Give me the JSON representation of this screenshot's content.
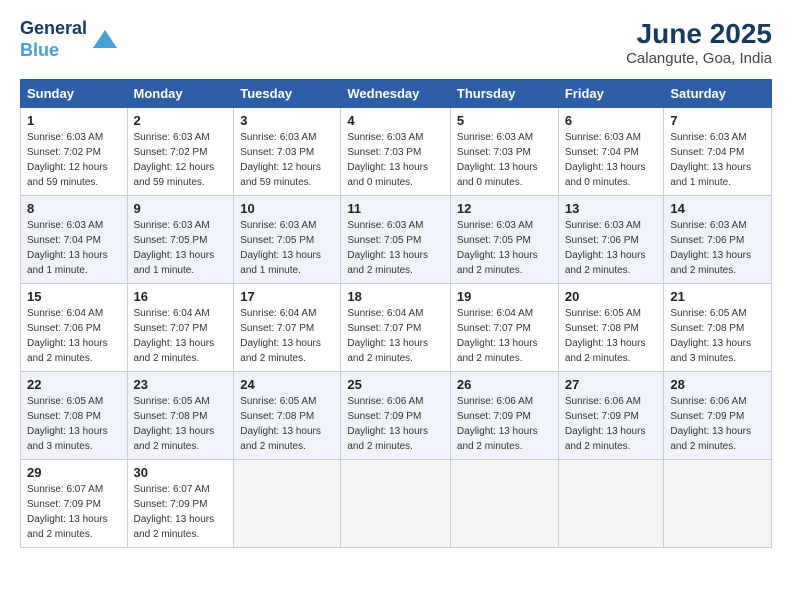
{
  "header": {
    "logo_line1": "General",
    "logo_line2": "Blue",
    "title": "June 2025",
    "subtitle": "Calangute, Goa, India"
  },
  "days_of_week": [
    "Sunday",
    "Monday",
    "Tuesday",
    "Wednesday",
    "Thursday",
    "Friday",
    "Saturday"
  ],
  "weeks": [
    [
      {
        "day": "1",
        "sunrise": "Sunrise: 6:03 AM",
        "sunset": "Sunset: 7:02 PM",
        "daylight": "Daylight: 12 hours and 59 minutes."
      },
      {
        "day": "2",
        "sunrise": "Sunrise: 6:03 AM",
        "sunset": "Sunset: 7:02 PM",
        "daylight": "Daylight: 12 hours and 59 minutes."
      },
      {
        "day": "3",
        "sunrise": "Sunrise: 6:03 AM",
        "sunset": "Sunset: 7:03 PM",
        "daylight": "Daylight: 12 hours and 59 minutes."
      },
      {
        "day": "4",
        "sunrise": "Sunrise: 6:03 AM",
        "sunset": "Sunset: 7:03 PM",
        "daylight": "Daylight: 13 hours and 0 minutes."
      },
      {
        "day": "5",
        "sunrise": "Sunrise: 6:03 AM",
        "sunset": "Sunset: 7:03 PM",
        "daylight": "Daylight: 13 hours and 0 minutes."
      },
      {
        "day": "6",
        "sunrise": "Sunrise: 6:03 AM",
        "sunset": "Sunset: 7:04 PM",
        "daylight": "Daylight: 13 hours and 0 minutes."
      },
      {
        "day": "7",
        "sunrise": "Sunrise: 6:03 AM",
        "sunset": "Sunset: 7:04 PM",
        "daylight": "Daylight: 13 hours and 1 minute."
      }
    ],
    [
      {
        "day": "8",
        "sunrise": "Sunrise: 6:03 AM",
        "sunset": "Sunset: 7:04 PM",
        "daylight": "Daylight: 13 hours and 1 minute."
      },
      {
        "day": "9",
        "sunrise": "Sunrise: 6:03 AM",
        "sunset": "Sunset: 7:05 PM",
        "daylight": "Daylight: 13 hours and 1 minute."
      },
      {
        "day": "10",
        "sunrise": "Sunrise: 6:03 AM",
        "sunset": "Sunset: 7:05 PM",
        "daylight": "Daylight: 13 hours and 1 minute."
      },
      {
        "day": "11",
        "sunrise": "Sunrise: 6:03 AM",
        "sunset": "Sunset: 7:05 PM",
        "daylight": "Daylight: 13 hours and 2 minutes."
      },
      {
        "day": "12",
        "sunrise": "Sunrise: 6:03 AM",
        "sunset": "Sunset: 7:05 PM",
        "daylight": "Daylight: 13 hours and 2 minutes."
      },
      {
        "day": "13",
        "sunrise": "Sunrise: 6:03 AM",
        "sunset": "Sunset: 7:06 PM",
        "daylight": "Daylight: 13 hours and 2 minutes."
      },
      {
        "day": "14",
        "sunrise": "Sunrise: 6:03 AM",
        "sunset": "Sunset: 7:06 PM",
        "daylight": "Daylight: 13 hours and 2 minutes."
      }
    ],
    [
      {
        "day": "15",
        "sunrise": "Sunrise: 6:04 AM",
        "sunset": "Sunset: 7:06 PM",
        "daylight": "Daylight: 13 hours and 2 minutes."
      },
      {
        "day": "16",
        "sunrise": "Sunrise: 6:04 AM",
        "sunset": "Sunset: 7:07 PM",
        "daylight": "Daylight: 13 hours and 2 minutes."
      },
      {
        "day": "17",
        "sunrise": "Sunrise: 6:04 AM",
        "sunset": "Sunset: 7:07 PM",
        "daylight": "Daylight: 13 hours and 2 minutes."
      },
      {
        "day": "18",
        "sunrise": "Sunrise: 6:04 AM",
        "sunset": "Sunset: 7:07 PM",
        "daylight": "Daylight: 13 hours and 2 minutes."
      },
      {
        "day": "19",
        "sunrise": "Sunrise: 6:04 AM",
        "sunset": "Sunset: 7:07 PM",
        "daylight": "Daylight: 13 hours and 2 minutes."
      },
      {
        "day": "20",
        "sunrise": "Sunrise: 6:05 AM",
        "sunset": "Sunset: 7:08 PM",
        "daylight": "Daylight: 13 hours and 2 minutes."
      },
      {
        "day": "21",
        "sunrise": "Sunrise: 6:05 AM",
        "sunset": "Sunset: 7:08 PM",
        "daylight": "Daylight: 13 hours and 3 minutes."
      }
    ],
    [
      {
        "day": "22",
        "sunrise": "Sunrise: 6:05 AM",
        "sunset": "Sunset: 7:08 PM",
        "daylight": "Daylight: 13 hours and 3 minutes."
      },
      {
        "day": "23",
        "sunrise": "Sunrise: 6:05 AM",
        "sunset": "Sunset: 7:08 PM",
        "daylight": "Daylight: 13 hours and 2 minutes."
      },
      {
        "day": "24",
        "sunrise": "Sunrise: 6:05 AM",
        "sunset": "Sunset: 7:08 PM",
        "daylight": "Daylight: 13 hours and 2 minutes."
      },
      {
        "day": "25",
        "sunrise": "Sunrise: 6:06 AM",
        "sunset": "Sunset: 7:09 PM",
        "daylight": "Daylight: 13 hours and 2 minutes."
      },
      {
        "day": "26",
        "sunrise": "Sunrise: 6:06 AM",
        "sunset": "Sunset: 7:09 PM",
        "daylight": "Daylight: 13 hours and 2 minutes."
      },
      {
        "day": "27",
        "sunrise": "Sunrise: 6:06 AM",
        "sunset": "Sunset: 7:09 PM",
        "daylight": "Daylight: 13 hours and 2 minutes."
      },
      {
        "day": "28",
        "sunrise": "Sunrise: 6:06 AM",
        "sunset": "Sunset: 7:09 PM",
        "daylight": "Daylight: 13 hours and 2 minutes."
      }
    ],
    [
      {
        "day": "29",
        "sunrise": "Sunrise: 6:07 AM",
        "sunset": "Sunset: 7:09 PM",
        "daylight": "Daylight: 13 hours and 2 minutes."
      },
      {
        "day": "30",
        "sunrise": "Sunrise: 6:07 AM",
        "sunset": "Sunset: 7:09 PM",
        "daylight": "Daylight: 13 hours and 2 minutes."
      },
      null,
      null,
      null,
      null,
      null
    ]
  ]
}
